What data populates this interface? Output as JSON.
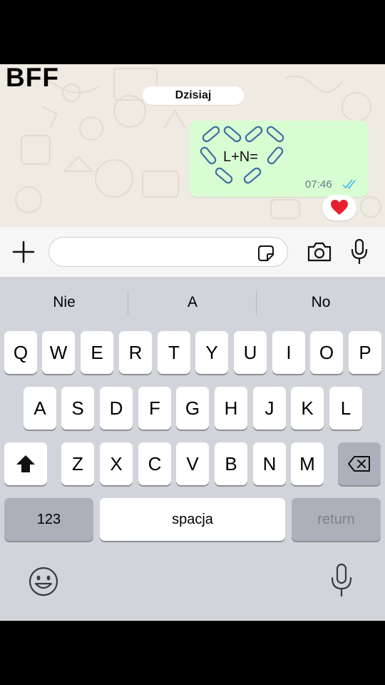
{
  "overlay": {
    "title": "BFF"
  },
  "chat": {
    "date_label": "Dzisiaj",
    "message": {
      "text": "L+N=",
      "time": "07:46",
      "status": "read-double-check",
      "reaction": "red-heart"
    }
  },
  "composer": {
    "placeholder": "",
    "value": ""
  },
  "keyboard": {
    "suggestions": [
      "Nie",
      "A",
      "No"
    ],
    "rows": [
      [
        "Q",
        "W",
        "E",
        "R",
        "T",
        "Y",
        "U",
        "I",
        "O",
        "P"
      ],
      [
        "A",
        "S",
        "D",
        "F",
        "G",
        "H",
        "J",
        "K",
        "L"
      ],
      [
        "Z",
        "X",
        "C",
        "V",
        "B",
        "N",
        "M"
      ]
    ],
    "numbers_label": "123",
    "space_label": "spacja",
    "return_label": "return"
  },
  "colors": {
    "bubble": "#d9fdd3",
    "chat_bg": "#efeae2",
    "keyboard_bg": "#d1d4da",
    "tick": "#53bdeb",
    "heart": "#e8202e"
  }
}
